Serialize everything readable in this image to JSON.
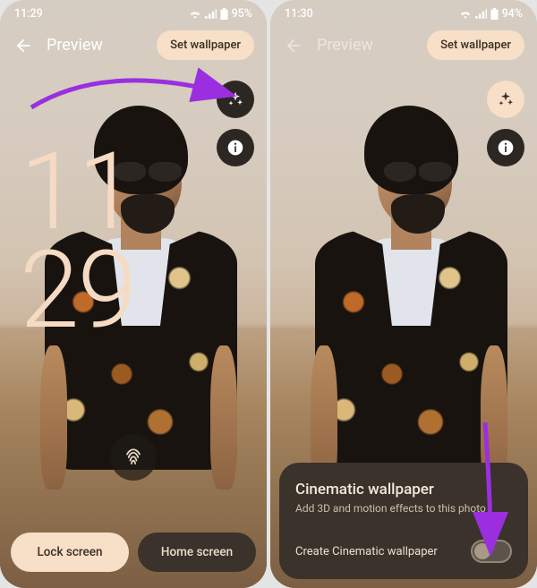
{
  "left": {
    "status": {
      "time": "11:29",
      "battery": "95%"
    },
    "header": {
      "title": "Preview",
      "set_wallpaper": "Set wallpaper"
    },
    "clock": {
      "hh": "11",
      "mm": "29"
    },
    "tabs": {
      "lock": "Lock screen",
      "home": "Home screen"
    },
    "icons": {
      "sparkle": "sparkle-icon",
      "info": "info-icon",
      "fingerprint": "fingerprint-icon",
      "back": "back-icon"
    }
  },
  "right": {
    "status": {
      "time": "11:30",
      "battery": "94%"
    },
    "header": {
      "title": "Preview",
      "set_wallpaper": "Set wallpaper"
    },
    "sheet": {
      "title": "Cinematic wallpaper",
      "subtitle": "Add 3D and motion effects to this photo",
      "toggle_label": "Create Cinematic wallpaper",
      "toggle_on": false
    },
    "icons": {
      "sparkle": "sparkle-icon",
      "info": "info-icon",
      "back": "back-icon"
    }
  },
  "colors": {
    "accent": "#f7dfc8",
    "panel": "#3a322b",
    "arrow": "#9b2fe0"
  }
}
